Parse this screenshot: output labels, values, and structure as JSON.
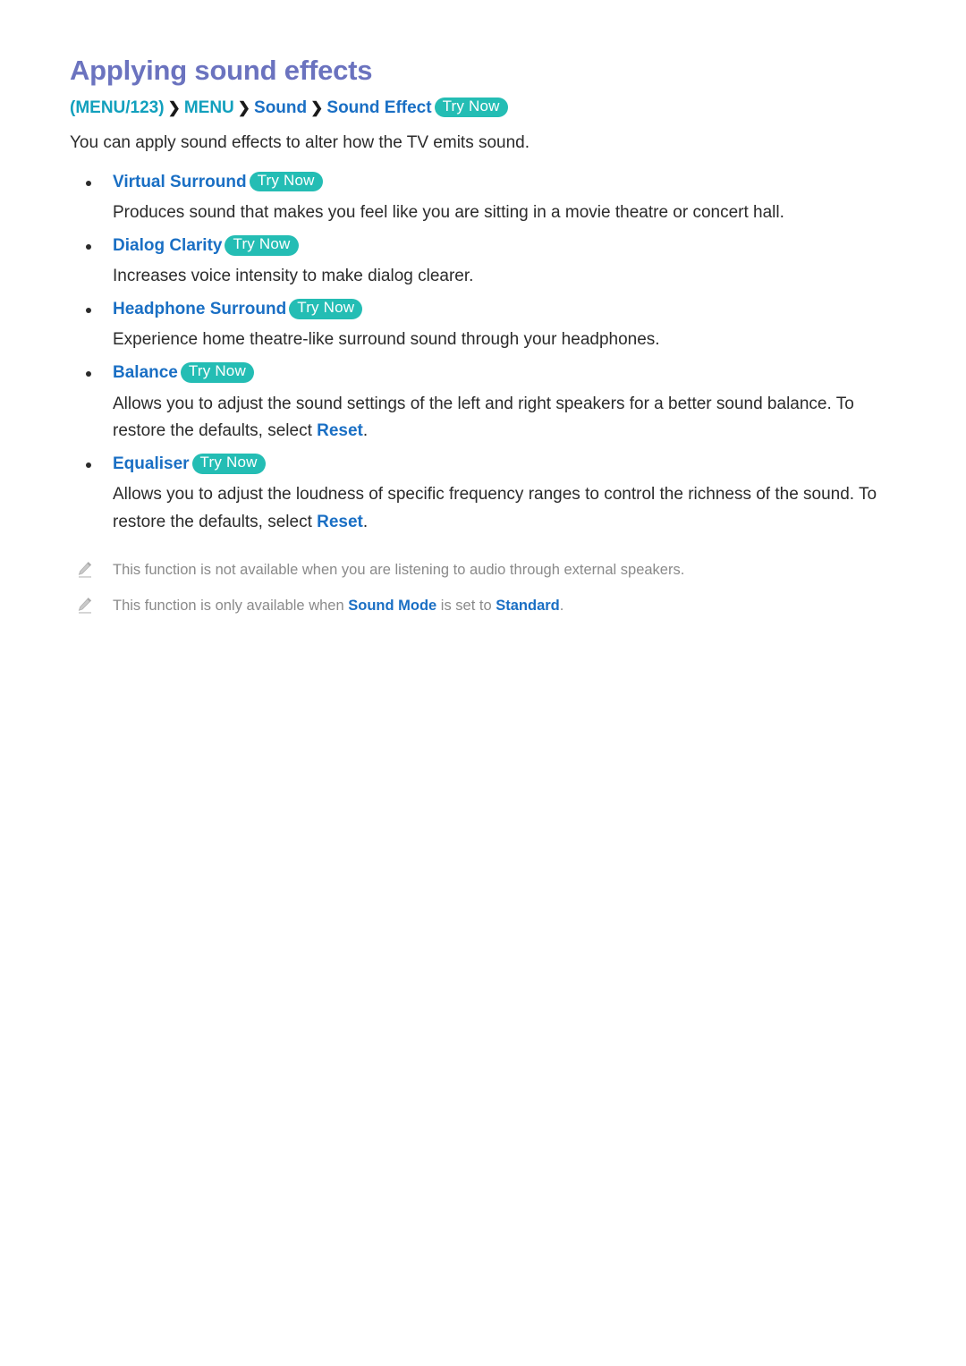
{
  "document": {
    "title": "Applying sound effects",
    "breadcrumb": {
      "open_paren": "(",
      "key": "MENU/123",
      "close_paren": ")",
      "separator": "❯",
      "menu": "MENU",
      "category": "Sound",
      "item": "Sound Effect",
      "try_now": "Try Now"
    },
    "intro": "You can apply sound effects to alter how the TV emits sound.",
    "features": [
      {
        "name": "Virtual Surround",
        "try_now": "Try Now",
        "description": "Produces sound that makes you feel like you are sitting in a movie theatre or concert hall."
      },
      {
        "name": "Dialog Clarity",
        "try_now": "Try Now",
        "description": "Increases voice intensity to make dialog clearer."
      },
      {
        "name": "Headphone Surround",
        "try_now": "Try Now",
        "description": "Experience home theatre-like surround sound through your headphones."
      },
      {
        "name": "Balance",
        "try_now": "Try Now",
        "description_before": "Allows you to adjust the sound settings of the left and right speakers for a better sound balance. To restore the defaults, select ",
        "description_link": "Reset",
        "description_after": "."
      },
      {
        "name": "Equaliser",
        "try_now": "Try Now",
        "description_before": "Allows you to adjust the loudness of specific frequency ranges to control the richness of the sound. To restore the defaults, select ",
        "description_link": "Reset",
        "description_after": "."
      }
    ],
    "notes": [
      {
        "text": "This function is not available when you are listening to audio through external speakers."
      },
      {
        "text_before": "This function is only available when ",
        "link1": "Sound Mode",
        "text_middle": " is set to ",
        "link2": "Standard",
        "text_after": "."
      }
    ],
    "colors": {
      "title": "#6b73bf",
      "teal": "#12a0bd",
      "blue": "#1a6fc4",
      "pill": "#24bdb4",
      "body": "#2b2b2b",
      "note": "#8a8a8a"
    }
  }
}
